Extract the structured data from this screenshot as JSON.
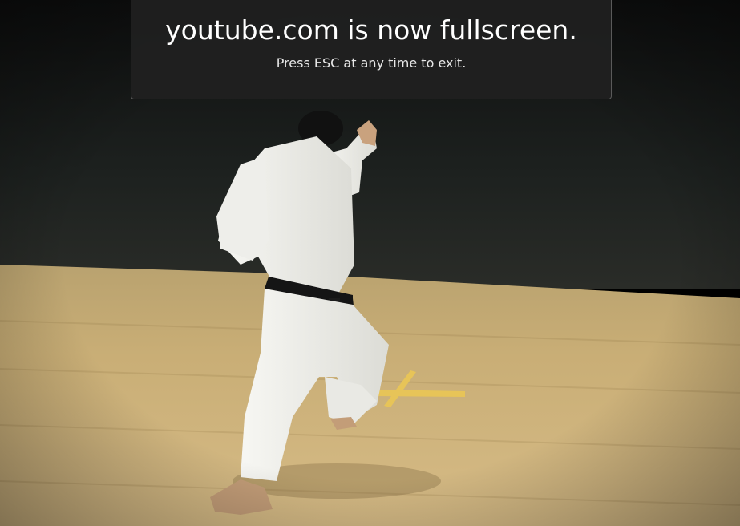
{
  "notice": {
    "title": "youtube.com is now fullscreen.",
    "subtitle": "Press ESC at any time to exit."
  },
  "colors": {
    "notice_bg": "#202020",
    "wall": "#1c1f1d",
    "floor": "#c8ac74",
    "gi": "#f2f2ee",
    "belt": "#161616"
  }
}
